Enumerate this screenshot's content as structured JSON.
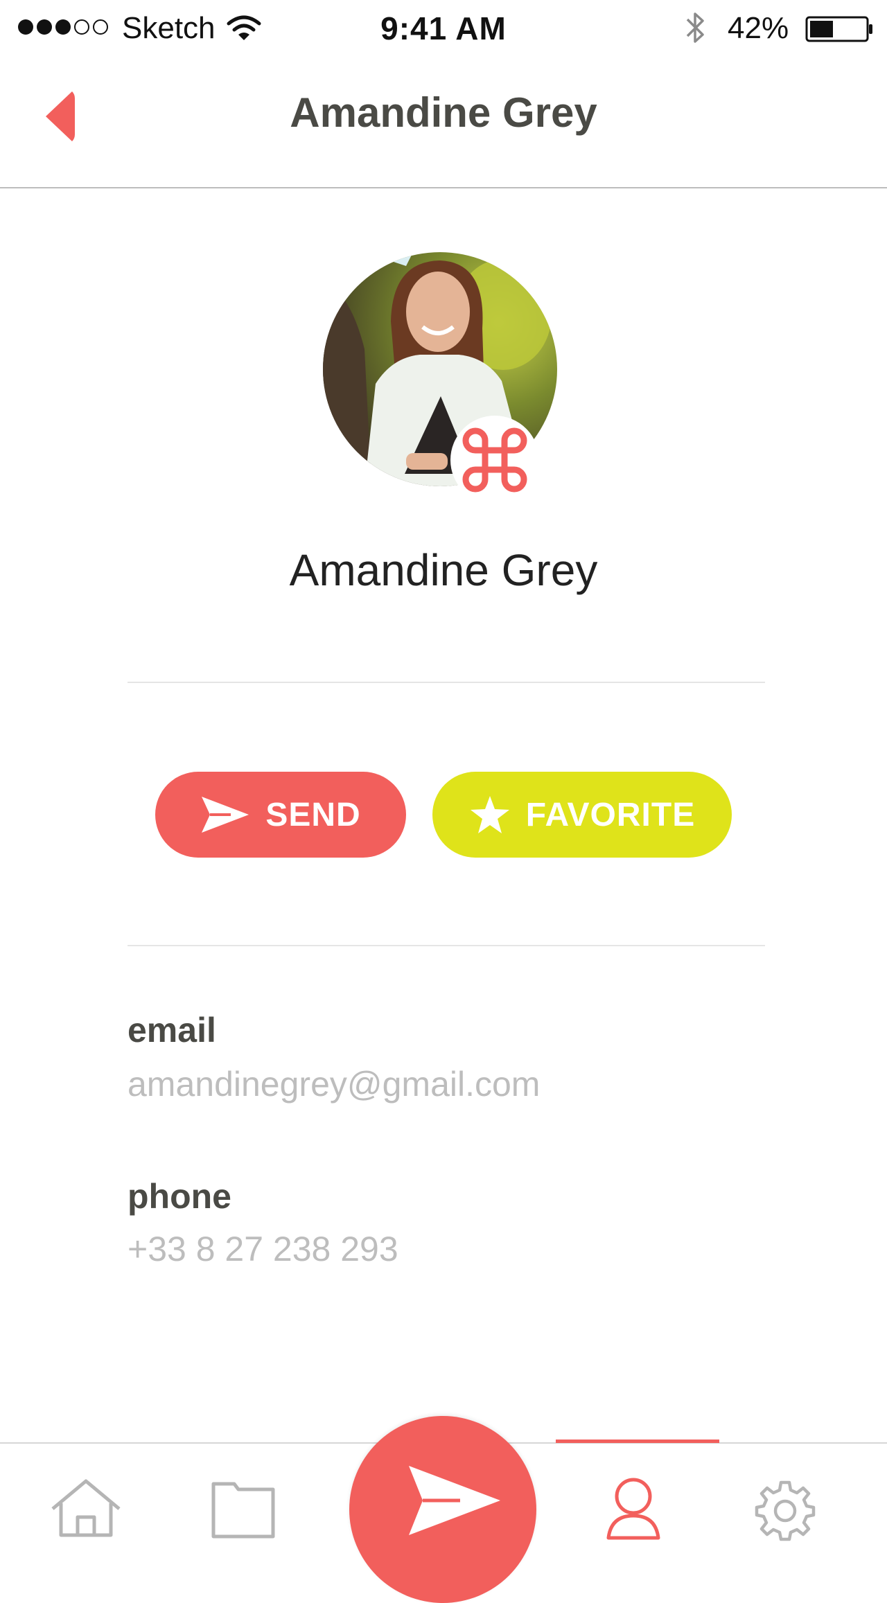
{
  "status_bar": {
    "carrier": "Sketch",
    "time": "9:41 AM",
    "battery": "42%",
    "battery_level": 0.42
  },
  "header": {
    "title": "Amandine Grey"
  },
  "profile": {
    "name": "Amandine Grey"
  },
  "actions": {
    "send_label": "SEND",
    "favorite_label": "FAVORITE"
  },
  "details": {
    "email_label": "email",
    "email_value": "amandinegrey@gmail.com",
    "phone_label": "phone",
    "phone_value": "+33 8 27 238 293"
  },
  "tab_bar": {
    "tabs": [
      "home",
      "folder",
      "send",
      "profile",
      "settings"
    ],
    "active": "profile"
  },
  "icons": {
    "back": "chevron-left-icon",
    "send": "paper-plane-icon",
    "favorite": "star-icon",
    "badge": "command-icon"
  },
  "colors": {
    "accent": "#f25f5c",
    "favorite": "#dfe31a",
    "title": "#4a4a45",
    "muted": "#bdbdbd"
  }
}
